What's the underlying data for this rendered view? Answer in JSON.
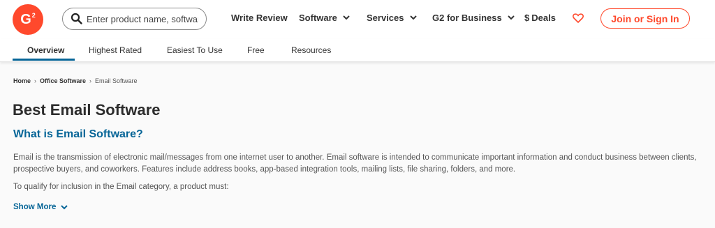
{
  "header": {
    "logo_text": "G",
    "logo_sup": "2",
    "search_placeholder": "Enter product name, software",
    "nav": [
      "Write Review",
      "Software",
      "Services",
      "G2 for Business"
    ],
    "deals_label": "Deals",
    "deals_symbol": "$",
    "join_label": "Join or Sign In",
    "accent_color": "#ff492c"
  },
  "subnav": {
    "tabs": [
      "Overview",
      "Highest Rated",
      "Easiest To Use",
      "Free",
      "Resources"
    ],
    "active_tab": "Overview"
  },
  "breadcrumb": [
    "Home",
    "Office Software",
    "Email Software"
  ],
  "main": {
    "title": "Best Email Software",
    "subtitle": "What is Email Software?",
    "description": "Email is the transmission of electronic mail/messages from one internet user to another. Email software is intended to communicate important information and conduct business between clients, prospective buyers, and coworkers. Features include address books, app-based integration tools, mailing lists, file sharing, folders, and more.",
    "qualify_text": "To qualify for inclusion in the Email category, a product must:",
    "show_more_label": "Show More",
    "link_color": "#066597"
  }
}
